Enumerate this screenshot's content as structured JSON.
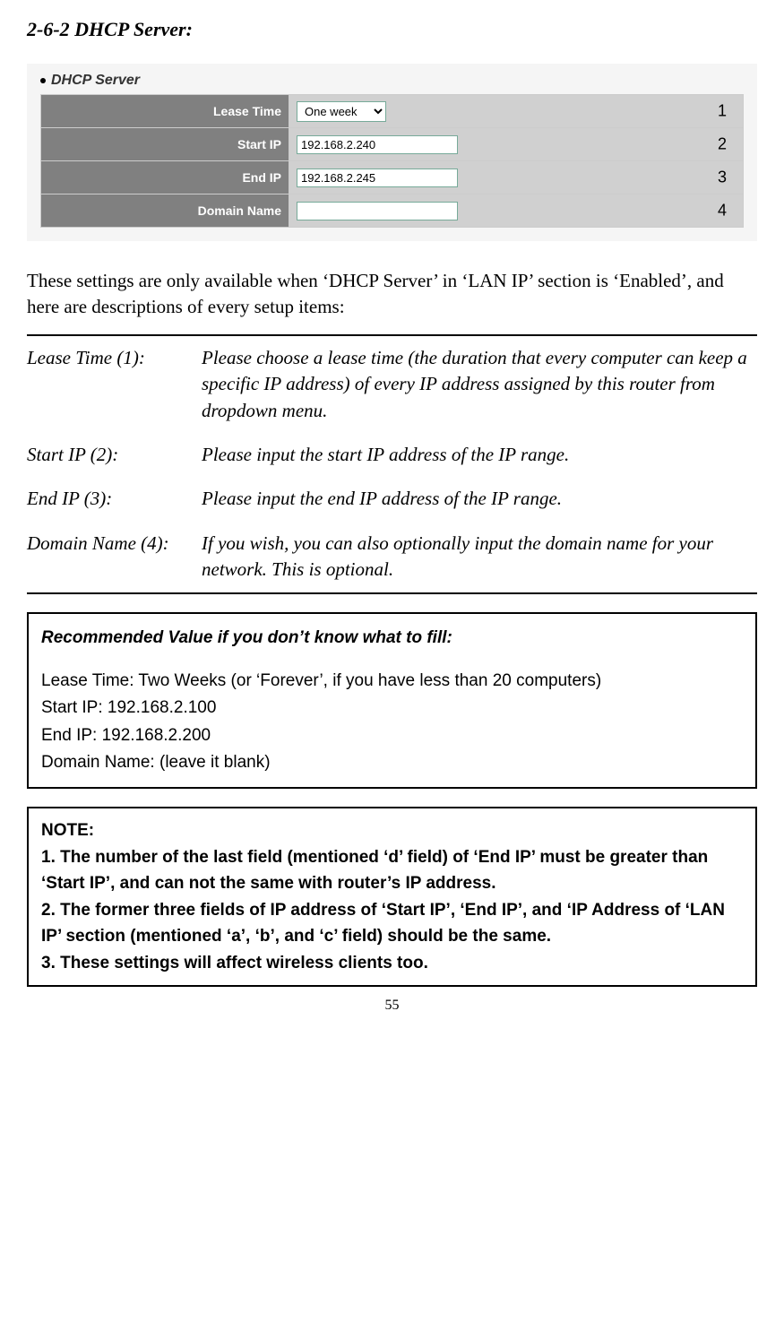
{
  "heading": "2-6-2 DHCP Server:",
  "screenshot": {
    "title": "DHCP Server",
    "rows": [
      {
        "label": "Lease Time",
        "type": "select",
        "value": "One week",
        "tag": "1"
      },
      {
        "label": "Start IP",
        "type": "text",
        "value": "192.168.2.240",
        "tag": "2"
      },
      {
        "label": "End IP",
        "type": "text",
        "value": "192.168.2.245",
        "tag": "3"
      },
      {
        "label": "Domain Name",
        "type": "text",
        "value": "",
        "tag": "4"
      }
    ]
  },
  "intro": "These settings are only available when ‘DHCP Server’ in ‘LAN IP’ section is ‘Enabled’, and here are descriptions of every setup items:",
  "settings": [
    {
      "name": "Lease Time (1):",
      "desc": "Please choose a lease time (the duration that every computer can keep a specific IP address) of every IP address assigned by this router from dropdown menu."
    },
    {
      "name": "Start IP (2):",
      "desc": "Please input the start IP address of the IP range."
    },
    {
      "name": "End IP (3):",
      "desc": "Please input the end IP address of the IP range."
    },
    {
      "name": "Domain Name (4):",
      "desc": "If you wish, you can also optionally input the domain name for your network. This is optional."
    }
  ],
  "recommended": {
    "title": "Recommended Value if you don’t know what to fill:",
    "lines": [
      "Lease Time: Two Weeks (or ‘Forever’, if you have less than 20 computers)",
      "Start IP: 192.168.2.100",
      "End IP: 192.168.2.200",
      "Domain Name: (leave it blank)"
    ]
  },
  "note": {
    "title": "NOTE:",
    "lines": [
      "1. The number of the last field (mentioned ‘d’ field) of ‘End IP’ must be greater than ‘Start IP’, and can not the same with router’s IP address.",
      "2. The former three fields of IP address of ‘Start IP’, ‘End IP’, and ‘IP Address of ‘LAN IP’ section (mentioned ‘a’, ‘b’, and ‘c’ field) should be the same.",
      "3. These settings will affect wireless clients too."
    ]
  },
  "page_number": "55"
}
